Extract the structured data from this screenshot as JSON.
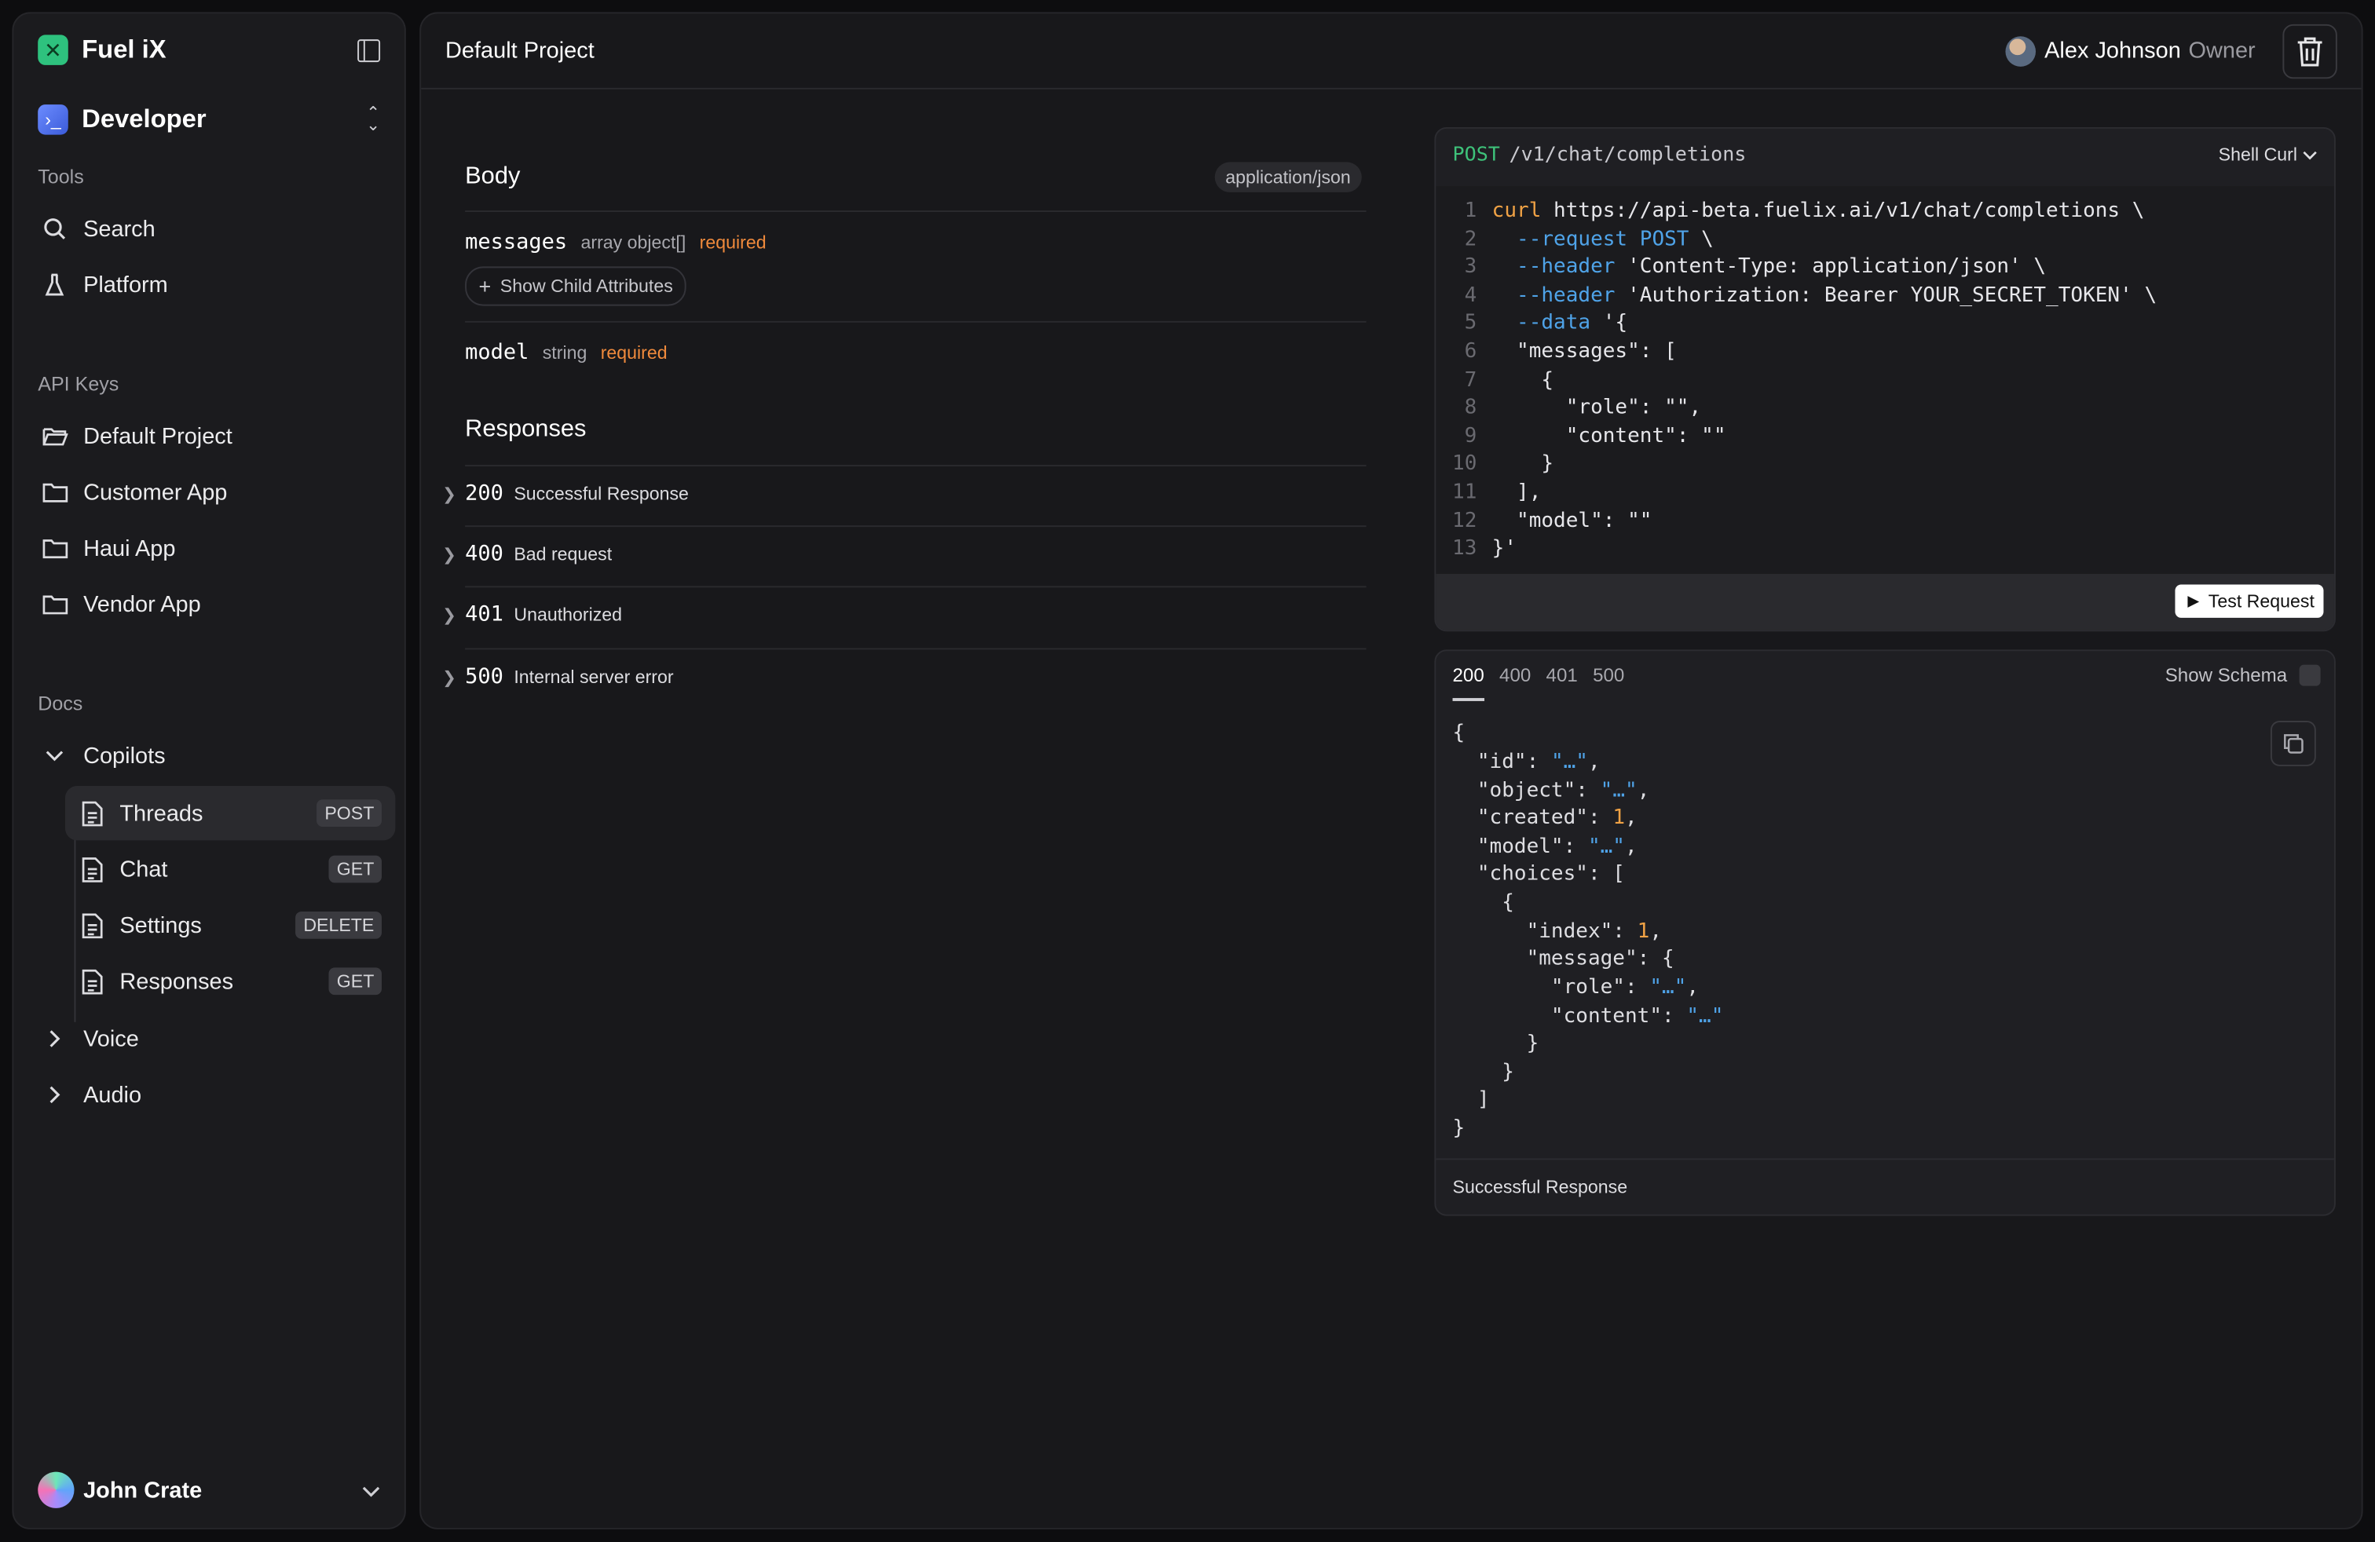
{
  "app": {
    "name": "Fuel iX"
  },
  "workspace": {
    "name": "Developer"
  },
  "sidebar": {
    "tools_label": "Tools",
    "tools": [
      {
        "label": "Search",
        "icon": "search-icon"
      },
      {
        "label": "Platform",
        "icon": "flask-icon"
      }
    ],
    "api_keys_label": "API Keys",
    "api_keys": [
      {
        "label": "Default Project",
        "icon": "folder-open-icon"
      },
      {
        "label": "Customer App",
        "icon": "folder-icon"
      },
      {
        "label": "Haui App",
        "icon": "folder-icon"
      },
      {
        "label": "Vendor App",
        "icon": "folder-icon"
      }
    ],
    "docs_label": "Docs",
    "docs": {
      "copilots": {
        "label": "Copilots",
        "items": [
          {
            "label": "Threads",
            "method": "POST"
          },
          {
            "label": "Chat",
            "method": "GET"
          },
          {
            "label": "Settings",
            "method": "DELETE"
          },
          {
            "label": "Responses",
            "method": "GET"
          }
        ]
      },
      "voice": "Voice",
      "audio": "Audio"
    },
    "user": {
      "name": "John Crate"
    }
  },
  "header": {
    "title": "Default Project",
    "owner_name": "Alex Johnson",
    "owner_role": "Owner"
  },
  "body_section": {
    "title": "Body",
    "content_type": "application/json",
    "params": [
      {
        "name": "messages",
        "type": "array object[]",
        "required": "required"
      },
      {
        "name": "model",
        "type": "string",
        "required": "required"
      }
    ],
    "child_button": "Show Child Attributes"
  },
  "responses_section": {
    "title": "Responses",
    "rows": [
      {
        "code": "200",
        "desc": "Successful Response"
      },
      {
        "code": "400",
        "desc": "Bad request"
      },
      {
        "code": "401",
        "desc": "Unauthorized"
      },
      {
        "code": "500",
        "desc": "Internal server error"
      }
    ]
  },
  "request_panel": {
    "method": "POST",
    "path": "/v1/chat/completions",
    "language": "Shell Curl",
    "line_numbers": [
      "1",
      "2",
      "3",
      "4",
      "5",
      "6",
      "7",
      "8",
      "9",
      "10",
      "11",
      "12",
      "13"
    ],
    "code": {
      "l1_cmd": "curl",
      "l1_rest": " https://api-beta.fuelix.ai/v1/chat/completions \\",
      "l2_flag": "  --request",
      "l2_val": " POST",
      "l2_rest": " \\",
      "l3_flag": "  --header",
      "l3_rest": " 'Content-Type: application/json' \\",
      "l4_flag": "  --header",
      "l4_rest": " 'Authorization: Bearer YOUR_SECRET_TOKEN' \\",
      "l5_flag": "  --data",
      "l5_rest": " '{",
      "l6": "  \"messages\": [",
      "l7": "    {",
      "l8": "      \"role\": \"\",",
      "l9": "      \"content\": \"\"",
      "l10": "    }",
      "l11": "  ],",
      "l12": "  \"model\": \"\"",
      "l13": "}'"
    },
    "test_button": "Test Request"
  },
  "response_panel": {
    "tabs": [
      "200",
      "400",
      "401",
      "500"
    ],
    "show_schema": "Show Schema",
    "json": {
      "open": "{",
      "id_key": "  \"id\": ",
      "id_val": "\"…\"",
      "comma": ",",
      "object_key": "  \"object\": ",
      "object_val": "\"…\"",
      "created_key": "  \"created\": ",
      "created_val": "1",
      "model_key": "  \"model\": ",
      "model_val": "\"…\"",
      "choices_key": "  \"choices\": [",
      "obj_open": "    {",
      "index_key": "      \"index\": ",
      "index_val": "1",
      "message_key": "      \"message\": {",
      "role_key": "        \"role\": ",
      "role_val": "\"…\"",
      "content_key": "        \"content\": ",
      "content_val": "\"…\"",
      "msg_close": "      }",
      "obj_close": "    }",
      "arr_close": "  ]",
      "close": "}"
    },
    "footer": "Successful Response"
  }
}
